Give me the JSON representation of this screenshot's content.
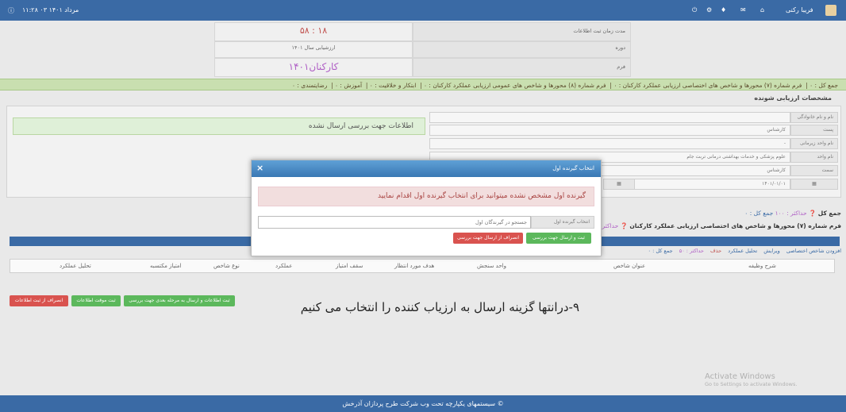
{
  "topbar": {
    "right_user": "فریبا رکنی",
    "left_datetime": "۱۱:۲۸ ۰۳ مرداد ۱۴۰۱"
  },
  "info": {
    "time_label": "مدت زمان ثبت اطلاعات",
    "time_value": "۱۸ : ۵۸",
    "period_label": "دوره",
    "period_value": "ارزشیابی سال ۱۴۰۱",
    "form_label": "فرم",
    "form_value": "کارکنان۱۴۰۱"
  },
  "summary": {
    "total": "جمع کل : ۰",
    "form7": "فرم شماره (۷) محورها و شاخص های اختصاصی ارزیابی عملکرد کارکنان : ۰",
    "form8": "فرم شماره (۸) محورها و شاخص های عمومی ارزیابی عملکرد کارکنان : ۰",
    "innovation": "ابتکار و خلاقیت : ۰",
    "training": "آموزش : ۰",
    "satisfaction": "رضایتمندی : ۰"
  },
  "evaluatee": {
    "title": "مشخصات ارزیابی شونده",
    "fields": [
      {
        "label": "نام و نام خانوادگی",
        "value": ""
      },
      {
        "label": "پست",
        "value": "کارشناس"
      },
      {
        "label": "نام واحد زیرمانی",
        "value": "-"
      },
      {
        "label": "نام واحد",
        "value": "علوم پزشکی و خدمات بهداشتی درمانی تربت جام"
      },
      {
        "label": "سمت",
        "value": "کارشناس"
      },
      {
        "label": "",
        "value": "۱۴۰۱/۰۱/۰۱"
      }
    ]
  },
  "no_info_msg": "اطلاعات جهت بررسی ارسال نشده",
  "score": {
    "total_prefix": "جمع کل",
    "max_label": "حداکثر : ۱۰۰",
    "total_sum": "جمع کل : ۰",
    "form7_title": "فرم شماره (۷) محورها و شاخص های اختصاصی ارزیابی عملکرد کارکنان",
    "form7_max": "حداکثر : ۵۰"
  },
  "table": {
    "toolbar": {
      "add": "افزودن شاخص اختصاصی",
      "edit": "ویرایش",
      "analysis": "تحلیل عملکرد",
      "delete": "حذف",
      "max": "حداکثر : ۵۰",
      "total": "جمع کل : ۰"
    },
    "headers": [
      "شرح وظیفه",
      "عنوان شاخص",
      "واحد سنجش",
      "هدف مورد انتظار",
      "سقف امتیاز",
      "عملکرد",
      "نوع شاخص",
      "امتیاز مکتسبه",
      "تحلیل عملکرد"
    ]
  },
  "buttons": {
    "cancel_submit": "انصراف از ثبت اطلاعات",
    "temp_save": "ثبت موقت اطلاعات",
    "submit_send": "ثبت اطلاعات و ارسال به مرحله بعدی جهت بررسی"
  },
  "modal": {
    "title": "انتخاب گیرنده اول",
    "alert": "گیرنده اول مشخص نشده میتوانید برای انتخاب گیرنده اول اقدام نمایید",
    "select_label": "انتخاب گیرنده اول",
    "search_placeholder": "جستجو در گیرندگان اول",
    "send_button": "ثبت و ارسال جهت بررسی",
    "cancel_button": "انصراف از ارسال جهت بررسی",
    "close": "×"
  },
  "caption": "۹-درانتها گزینه ارسال به ارزیاب کننده را انتخاب می کنیم",
  "watermark": {
    "line1": "Activate Windows",
    "line2": "Go to Settings to activate Windows."
  },
  "footer": "سیستمهای یکپارچه تحت وب شرکت طرح پردازان آذرخش",
  "colors": {
    "topbar": "#3a6aa5",
    "green_bar": "#c9dfb0",
    "alert_bg": "#f2dede",
    "primary_red": "#d9534f",
    "primary_green": "#5cb85c",
    "form_value": "#b061c6"
  }
}
